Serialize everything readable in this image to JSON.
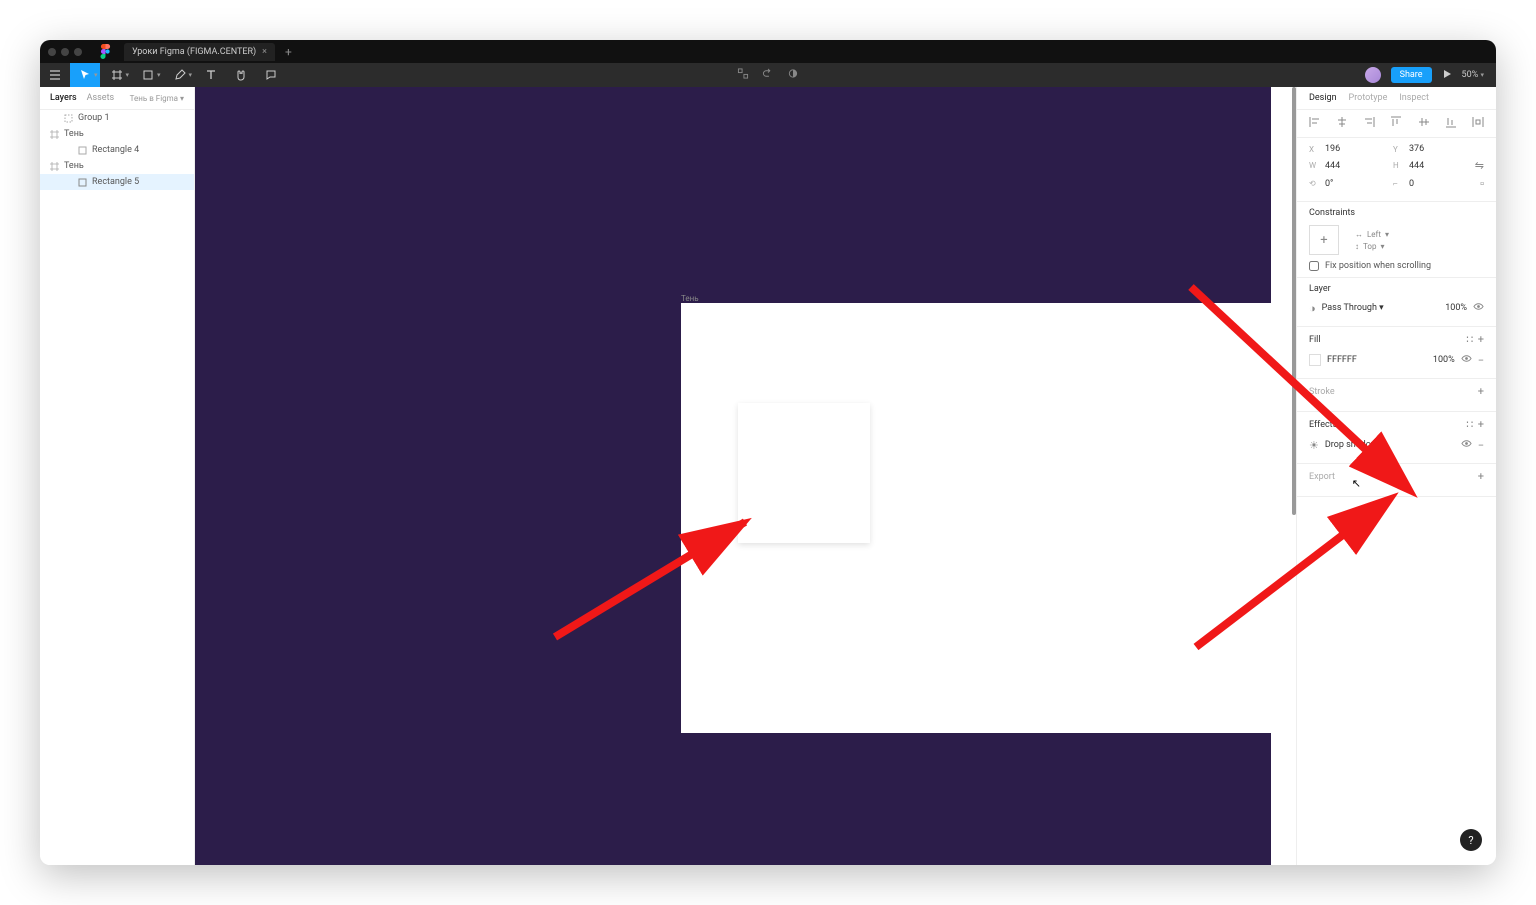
{
  "window": {
    "tab_title": "Уроки Figma (FIGMA.CENTER)"
  },
  "toolbar": {
    "share": "Share",
    "zoom": "50%"
  },
  "left": {
    "tab_layers": "Layers",
    "tab_assets": "Assets",
    "page": "Тень в Figma",
    "layers": {
      "group1": "Group 1",
      "frame_a": "Тень",
      "rect4": "Rectangle 4",
      "frame_b": "Тень",
      "rect5": "Rectangle 5"
    }
  },
  "canvas": {
    "frame_name": "Тень"
  },
  "right": {
    "tab_design": "Design",
    "tab_prototype": "Prototype",
    "tab_inspect": "Inspect",
    "x": "196",
    "y": "376",
    "w": "444",
    "h": "444",
    "rot": "0°",
    "rad": "0",
    "constraints_title": "Constraints",
    "c_h": "Left",
    "c_v": "Top",
    "fix": "Fix position when scrolling",
    "layer_title": "Layer",
    "blend": "Pass Through",
    "opacity": "100%",
    "fill_title": "Fill",
    "fill_hex": "FFFFFF",
    "fill_op": "100%",
    "stroke_title": "Stroke",
    "effects_title": "Effects",
    "effect_name": "Drop shadow",
    "export_title": "Export"
  },
  "help": "?"
}
